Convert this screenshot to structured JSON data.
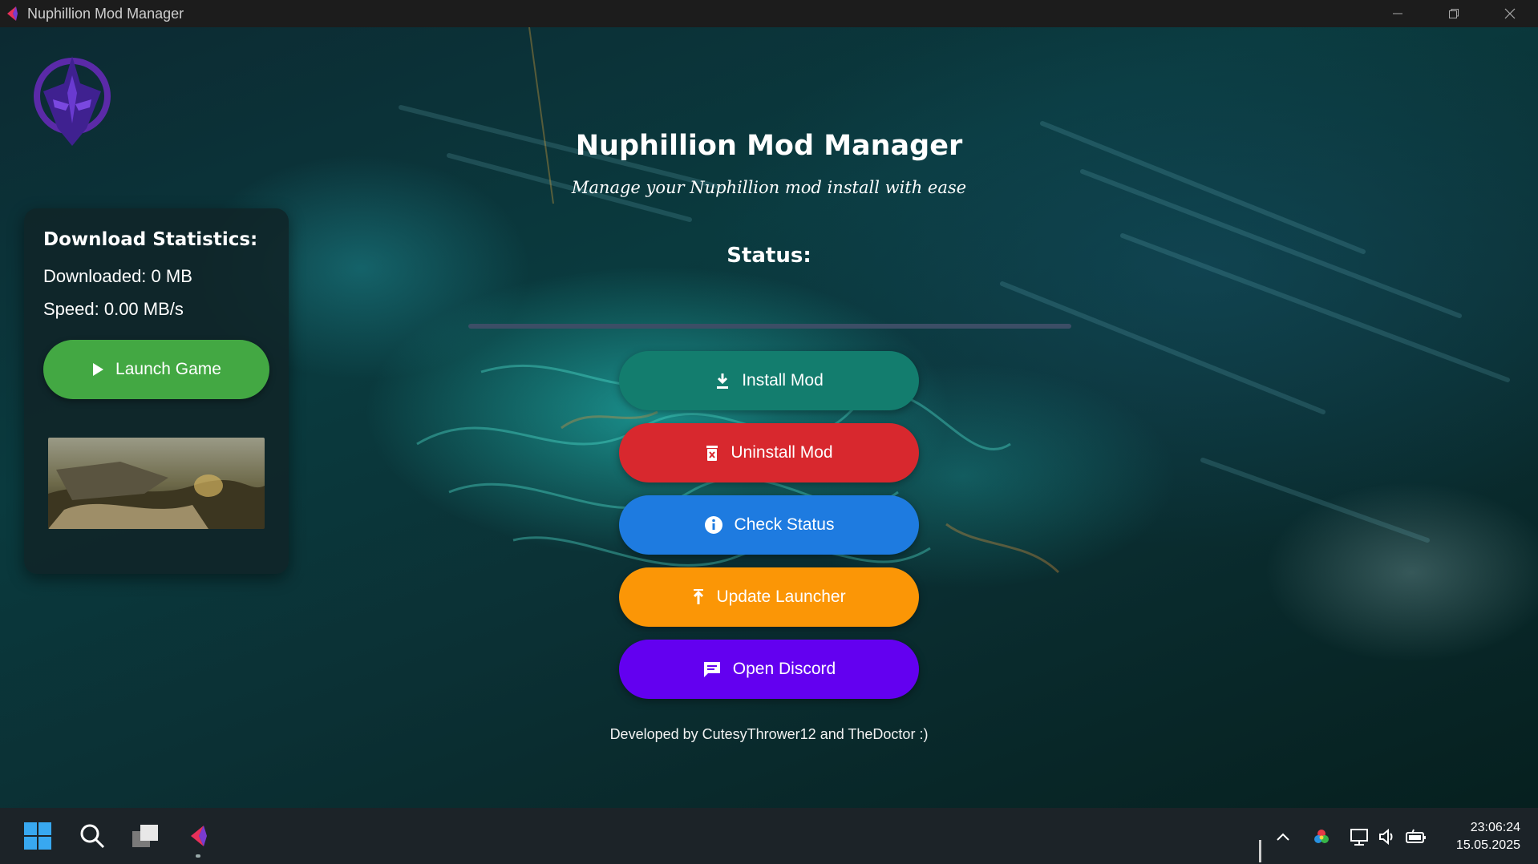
{
  "window": {
    "title": "Nuphillion Mod Manager"
  },
  "header": {
    "title": "Nuphillion Mod Manager",
    "subtitle": "Manage your Nuphillion mod install with ease",
    "status_label": "Status:"
  },
  "progress": {
    "value": 0
  },
  "sidebar": {
    "stats_title": "Download Statistics:",
    "downloaded": "Downloaded: 0 MB",
    "speed": "Speed: 0.00 MB/s",
    "launch_label": "Launch Game"
  },
  "actions": [
    {
      "label": "Install Mod",
      "icon": "download-icon",
      "color": "#137d6e"
    },
    {
      "label": "Uninstall Mod",
      "icon": "trash-icon",
      "color": "#d8282e"
    },
    {
      "label": "Check Status",
      "icon": "info-icon",
      "color": "#1e7be0"
    },
    {
      "label": "Update Launcher",
      "icon": "upload-icon",
      "color": "#fb9606"
    },
    {
      "label": "Open Discord",
      "icon": "chat-icon",
      "color": "#6300f0"
    }
  ],
  "footer": {
    "credits": "Developed by CutesyThrower12 and TheDoctor :)"
  },
  "taskbar": {
    "time": "23:06:24",
    "date": "15.05.2025"
  },
  "colors": {
    "launch_button": "#43a843",
    "titlebar": "#1c1c1c",
    "taskbar": "#1c2328"
  }
}
